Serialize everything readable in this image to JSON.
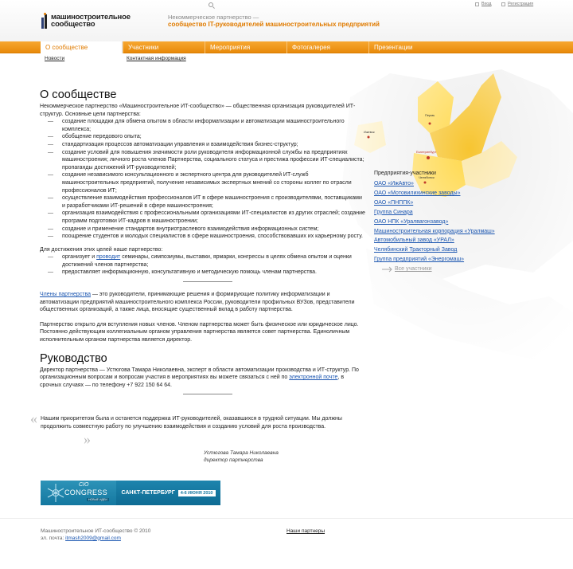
{
  "header": {
    "logo_line1": "машиностроительное",
    "logo_line2": "сообщество",
    "tagline_line1": "Некоммерческое партнерство —",
    "tagline_line2": "сообщество IT-руководителей машиностроительных предприятий",
    "login": "Вход",
    "register": "Регистрация"
  },
  "nav": {
    "items": [
      "О сообществе",
      "Участники",
      "Мероприятия",
      "Фотогалерея",
      "Презентации"
    ],
    "sub": [
      "Новости",
      "Контактная информация"
    ]
  },
  "map": {
    "labels": [
      "Пермь",
      "Ижевск",
      "Екатеринбург",
      "Челябинск"
    ],
    "highlight_color": "#f7c531"
  },
  "main": {
    "title": "О сообществе",
    "intro": "Некоммерческое партнерство «Машиностроительное ИТ-сообщество» — общественная организация руководителей ИТ-структур. Основные цели партнерства:",
    "goals": [
      "создание площадки для обмена опытом в области информатизации и автоматизации машиностроительного комплекса;",
      "обобщение передового опыта;",
      "стандартизация процессов автоматизации управления и взаимодействия бизнес-структур;",
      "создание условий для повышения значимости роли руководителя информационной службы на предприятиях машиностроения; личного роста членов Партнерства, социального статуса и престижа профессии ИТ-специалиста; пропаганды достижений ИТ-руководителей;",
      "создание независимого консультационного и экспертного центра для руководителей ИТ-служб машиностроительных предприятий, получение независимых экспертных мнений со стороны коллег по отрасли профессионалов ИТ;",
      "осуществление взаимодействия профессионалов ИТ в сфере машиностроения с производителями, поставщиками и разработчиками ИТ-решений в сфере машиностроения;",
      "организация взаимодействия с профессиональными организациями ИТ-специалистов из других отраслей; создание программ подготовки ИТ-кадров в машиностроении;",
      "создание и применение стандартов внутриотраслевого взаимодействия информационных систем;",
      "поощрение студентов и молодых специалистов в сфере машиностроения, способствовавших их карьерному росту."
    ],
    "means_intro": "Для достижения этих целей наше партнерство:",
    "means": [
      {
        "pre": "организует и ",
        "link": "проводит",
        "post": " семинары, симпозиумы, выставки, ярмарки, конгрессы в целях обмена опытом и оценки достижений членов партнерства;"
      },
      {
        "pre": "предоставляет информационную, консультативную и методическую помощь членам партнерства.",
        "link": "",
        "post": ""
      }
    ],
    "members_link": "Члены партнерства",
    "members_text": " — это руководители, принимающие решения и формирующие политику информатизации и автоматизации предприятий машиностроительного комплекса России, руководители профильных ВУЗов, представители общественных организаций, а также лица, вносящие существенный вклад в работу партнерства.",
    "open_text": "Партнерство открыто для вступления новых членов. Членом партнерства может быть физическое или юридическое лицо. Постоянно действующим коллегиальным органом управления партнерства является совет партнерства. Единоличным исполнительным органом партнерства является директор.",
    "leadership_title": "Руководство",
    "leadership_pre": "Директор партнерства — Устюгова Тамара Николаевна, эксперт в области автоматизации производства и ИТ-структур. По организационным вопросам и вопросам участия в мероприятиях вы можете связаться с ней по ",
    "leadership_link": "электронной почте",
    "leadership_post": ", в срочных случаях — по телефону +7 922 150 64 64.",
    "quote": "Нашим приоритетом была и останется поддержка ИТ-руководителей, оказавшихся в трудной ситуации. Мы должны продолжить совместную работу по улучшению взаимодействия и созданию условий для роста производства.",
    "sign_name": "Устюгова Тамара Николаевна",
    "sign_role": "директор партнерства"
  },
  "banner": {
    "cio": "CIO",
    "congress": "CONGRESS",
    "sub": "НОВЫЕ ИДЕИ",
    "city": "САНКТ-ПЕТЕРБУРГ",
    "dates": "4-6 ИЮНЯ 2010"
  },
  "sidebar": {
    "title": "Предприятия-участники",
    "items": [
      "ОАО «ИжАвто»",
      "ОАО «Мотовилихинские заводы»",
      "ОАО «ПНППК»",
      "Группа Синара",
      "ОАО НПК «Уралвагонзавод»",
      "Машиностроительная корпорация «Уралмаш»",
      "Автомобильный завод «УРАЛ»",
      "Челябинский Тракторный Завод",
      "Группа предприятий «Энергомаш»"
    ],
    "all": "Все участники"
  },
  "footer": {
    "copyright": "Машиностроительное ИТ-сообщество © 2010",
    "email_label": "эл. почта: ",
    "email": "itmash2009@gmail.com",
    "partners": "Наши партнеры"
  }
}
